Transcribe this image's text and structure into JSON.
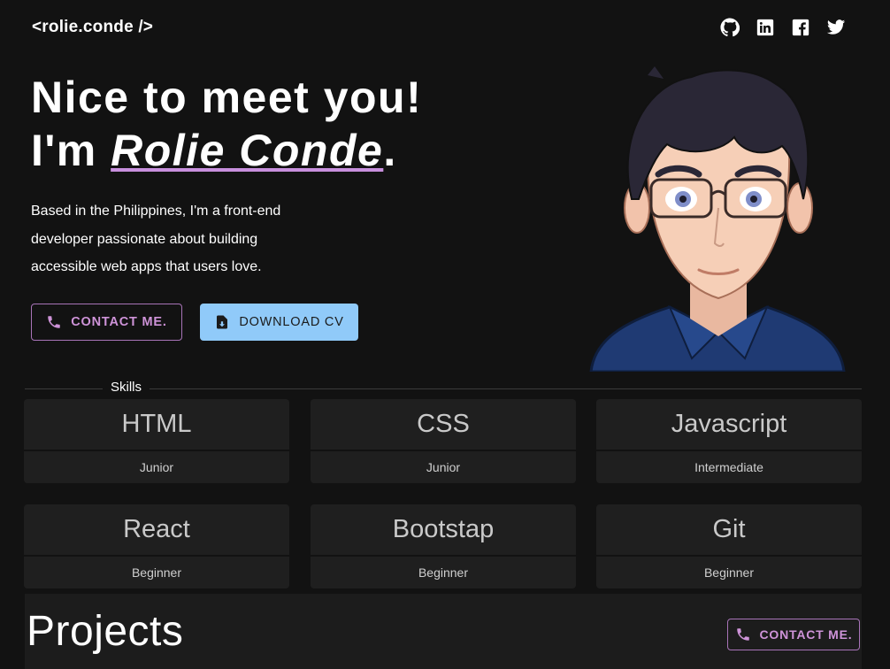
{
  "header": {
    "logo": "<rolie.conde />",
    "socials": [
      {
        "name": "github",
        "icon": "github-icon"
      },
      {
        "name": "linkedin",
        "icon": "linkedin-icon"
      },
      {
        "name": "facebook",
        "icon": "facebook-icon"
      },
      {
        "name": "twitter",
        "icon": "twitter-icon"
      }
    ]
  },
  "hero": {
    "greeting": "Nice to meet you!",
    "intro_prefix": "I'm ",
    "name": "Rolie Conde",
    "intro_suffix": ".",
    "description": "Based in the Philippines, I'm a front-end developer passionate about building accessible web apps that users love.",
    "contact_label": "CONTACT ME.",
    "download_label": "DOWNLOAD CV"
  },
  "skills": {
    "heading": "Skills",
    "items": [
      {
        "name": "HTML",
        "level": "Junior"
      },
      {
        "name": "CSS",
        "level": "Junior"
      },
      {
        "name": "Javascript",
        "level": "Intermediate"
      },
      {
        "name": "React",
        "level": "Beginner"
      },
      {
        "name": "Bootstap",
        "level": "Beginner"
      },
      {
        "name": "Git",
        "level": "Beginner"
      }
    ]
  },
  "projects": {
    "title": "Projects",
    "contact_label": "CONTACT ME."
  },
  "colors": {
    "background": "#121212",
    "accent_purple": "#ce93d8",
    "accent_blue": "#90caf9",
    "card": "#1f1f1f"
  }
}
